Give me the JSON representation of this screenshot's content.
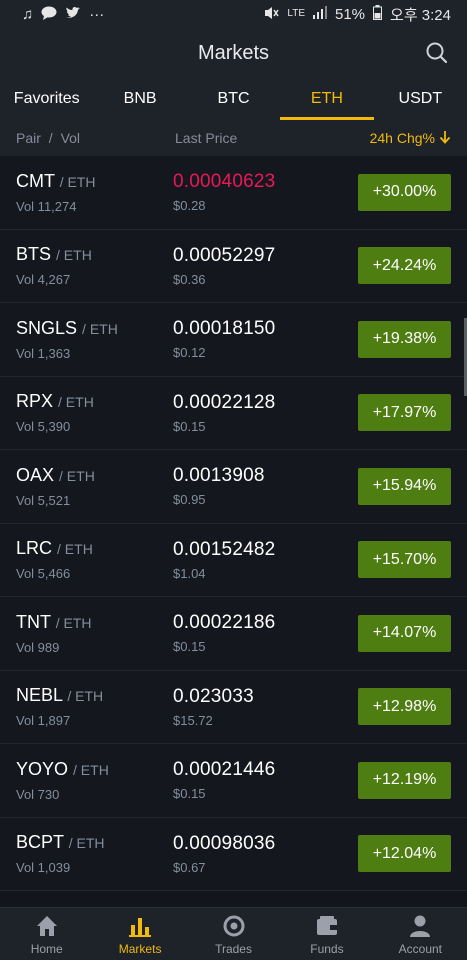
{
  "status": {
    "battery": "51%",
    "clock": "오후 3:24",
    "network": "LTE"
  },
  "header": {
    "title": "Markets"
  },
  "tabs": [
    {
      "label": "Favorites"
    },
    {
      "label": "BNB"
    },
    {
      "label": "BTC"
    },
    {
      "label": "ETH"
    },
    {
      "label": "USDT"
    }
  ],
  "columns": {
    "pair": "Pair",
    "sep": "/",
    "vol": "Vol",
    "last_price": "Last Price",
    "change": "24h Chg%"
  },
  "rows": [
    {
      "base": "CMT",
      "quote": "/ ETH",
      "vol": "Vol 11,274",
      "price": "0.00040623",
      "usd": "$0.28",
      "chg": "+30.00%"
    },
    {
      "base": "BTS",
      "quote": "/ ETH",
      "vol": "Vol 4,267",
      "price": "0.00052297",
      "usd": "$0.36",
      "chg": "+24.24%"
    },
    {
      "base": "SNGLS",
      "quote": "/ ETH",
      "vol": "Vol 1,363",
      "price": "0.00018150",
      "usd": "$0.12",
      "chg": "+19.38%"
    },
    {
      "base": "RPX",
      "quote": "/ ETH",
      "vol": "Vol 5,390",
      "price": "0.00022128",
      "usd": "$0.15",
      "chg": "+17.97%"
    },
    {
      "base": "OAX",
      "quote": "/ ETH",
      "vol": "Vol 5,521",
      "price": "0.0013908",
      "usd": "$0.95",
      "chg": "+15.94%"
    },
    {
      "base": "LRC",
      "quote": "/ ETH",
      "vol": "Vol 5,466",
      "price": "0.00152482",
      "usd": "$1.04",
      "chg": "+15.70%"
    },
    {
      "base": "TNT",
      "quote": "/ ETH",
      "vol": "Vol 989",
      "price": "0.00022186",
      "usd": "$0.15",
      "chg": "+14.07%"
    },
    {
      "base": "NEBL",
      "quote": "/ ETH",
      "vol": "Vol 1,897",
      "price": "0.023033",
      "usd": "$15.72",
      "chg": "+12.98%"
    },
    {
      "base": "YOYO",
      "quote": "/ ETH",
      "vol": "Vol 730",
      "price": "0.00021446",
      "usd": "$0.15",
      "chg": "+12.19%"
    },
    {
      "base": "BCPT",
      "quote": "/ ETH",
      "vol": "Vol 1,039",
      "price": "0.00098036",
      "usd": "$0.67",
      "chg": "+12.04%"
    }
  ],
  "nav": [
    {
      "label": "Home"
    },
    {
      "label": "Markets"
    },
    {
      "label": "Trades"
    },
    {
      "label": "Funds"
    },
    {
      "label": "Account"
    }
  ],
  "colors": {
    "accent": "#f0b90b",
    "up_badge": "#4e7d12",
    "highlight_price": "#e8185b"
  }
}
